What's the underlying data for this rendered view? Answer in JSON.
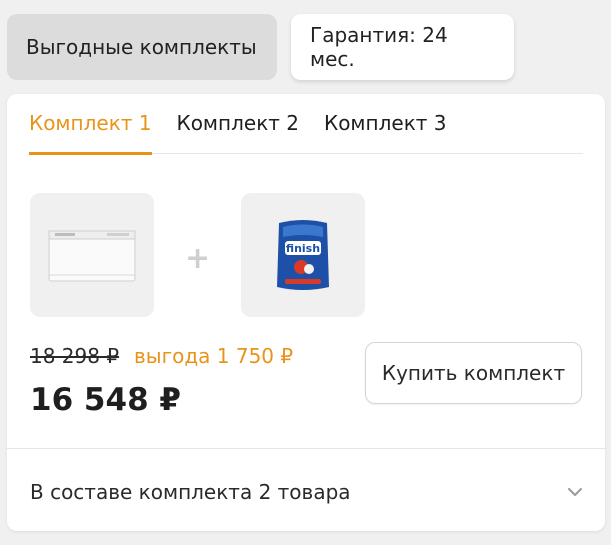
{
  "top_tabs": [
    {
      "label": "Выгодные комплекты",
      "active": true
    },
    {
      "label": "Гарантия: 24 мес.",
      "active": false
    }
  ],
  "kit_tabs": [
    {
      "label": "Комплект 1",
      "active": true
    },
    {
      "label": "Комплект 2",
      "active": false
    },
    {
      "label": "Комплект 3",
      "active": false
    }
  ],
  "products": [
    {
      "icon": "dishwasher-image"
    },
    {
      "icon": "finish-detergent-image",
      "brand": "finish"
    }
  ],
  "plus_symbol": "+",
  "pricing": {
    "old_price": "18 298 ₽",
    "saving": "выгода 1 750 ₽",
    "new_price": "16 548 ₽"
  },
  "buy_button": {
    "label": "Купить комплект"
  },
  "composition": {
    "label": "В составе комплекта 2 товара"
  },
  "colors": {
    "accent": "#e8941a",
    "active_pill_bg": "#dcdcdc",
    "background": "#f0f0f0"
  }
}
